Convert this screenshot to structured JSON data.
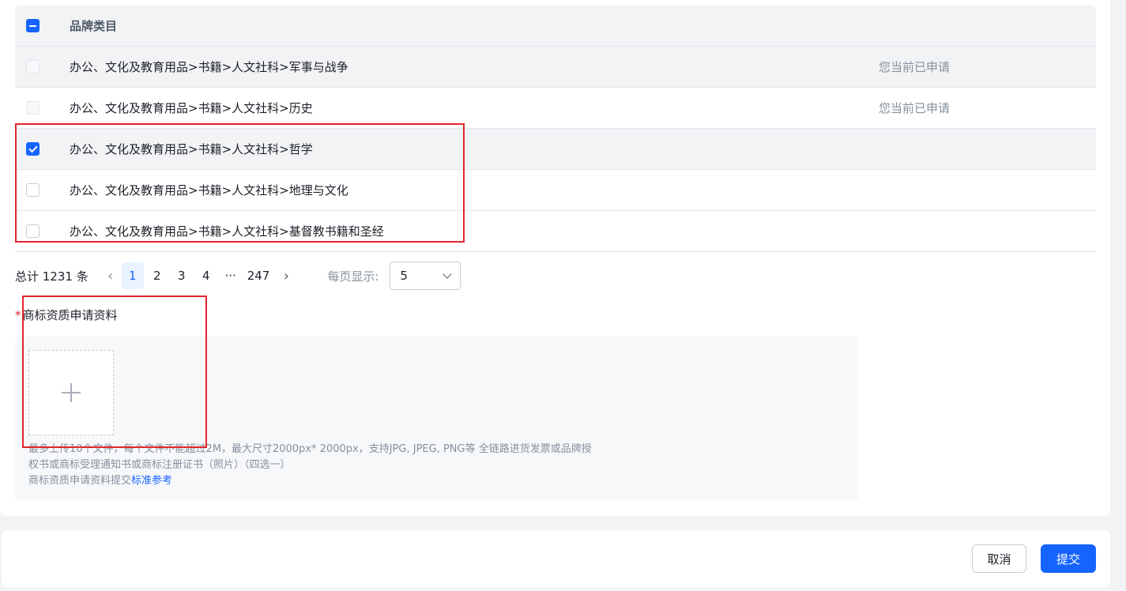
{
  "table": {
    "header": "品牌类目",
    "rows": [
      {
        "name": "办公、文化及教育用品>书籍>人文社科>军事与战争",
        "status": "您当前已申请"
      },
      {
        "name": "办公、文化及教育用品>书籍>人文社科>历史",
        "status": "您当前已申请"
      },
      {
        "name": "办公、文化及教育用品>书籍>人文社科>哲学",
        "status": ""
      },
      {
        "name": "办公、文化及教育用品>书籍>人文社科>地理与文化",
        "status": ""
      },
      {
        "name": "办公、文化及教育用品>书籍>人文社科>基督教书籍和圣经",
        "status": ""
      }
    ]
  },
  "pagination": {
    "total": "总计 1231 条",
    "prev": "‹",
    "pages": [
      "1",
      "2",
      "3",
      "4",
      "···",
      "247"
    ],
    "next": "›",
    "per_page_label": "每页显示:",
    "per_page_value": "5"
  },
  "upload": {
    "required_mark": "*",
    "label": "商标资质申请资料",
    "hint_line1": "最多上传10个文件，每个文件不能超过2M，最大尺寸2000px* 2000px，支持JPG, JPEG, PNG等 全链路进货发票或品牌授",
    "hint_line2": "权书或商标受理通知书或商标注册证书（照片）（四选一）",
    "hint_line3": "商标资质申请资料提交",
    "hint_link": "标准参考"
  },
  "footer": {
    "cancel": "取消",
    "submit": "提交"
  },
  "colors": {
    "primary": "#1664ff",
    "annotation": "#e0262d"
  }
}
